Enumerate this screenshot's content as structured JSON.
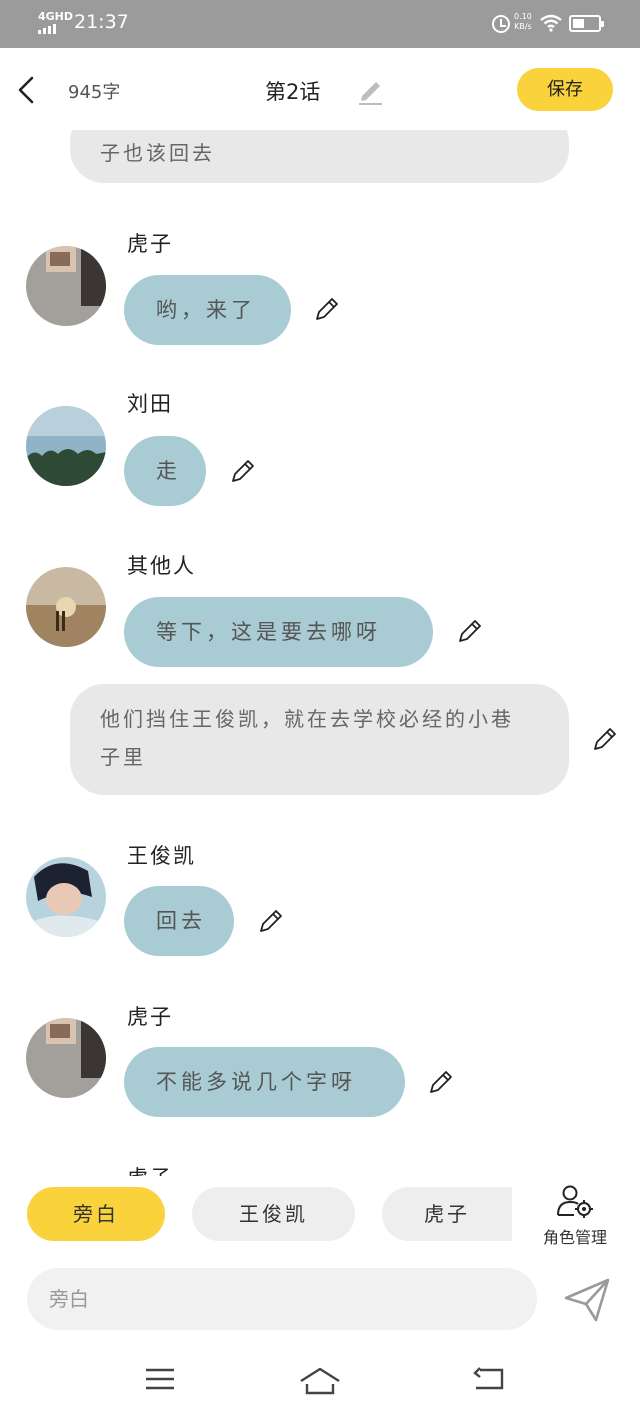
{
  "status_bar": {
    "network": "4GHD",
    "time": "21:37",
    "speed_value": "0.10",
    "speed_unit": "KB/s",
    "battery_level": 0.45
  },
  "header": {
    "word_count": "945字",
    "title": "第2话",
    "save_label": "保存"
  },
  "narrations": {
    "top": "子也该回去",
    "middle": "他们挡住王俊凯，就在去学校必经的小巷子里"
  },
  "messages": [
    {
      "name": "虎子",
      "text": "哟，来了"
    },
    {
      "name": "刘田",
      "text": "走"
    },
    {
      "name": "其他人",
      "text": "等下，这是要去哪呀"
    },
    {
      "name": "王俊凯",
      "text": "回去"
    },
    {
      "name": "虎子",
      "text": "不能多说几个字呀"
    },
    {
      "name": "虎子"
    }
  ],
  "role_bar": {
    "roles": [
      "旁白",
      "王俊凯",
      "虎子"
    ],
    "active_index": 0,
    "manage_label": "角色管理"
  },
  "input": {
    "placeholder": "旁白"
  },
  "colors": {
    "accent": "#fad23c",
    "bubble": "#a9ccd4",
    "narration_bg": "#e8e8e8",
    "status_bar": "#9b9b9b"
  }
}
